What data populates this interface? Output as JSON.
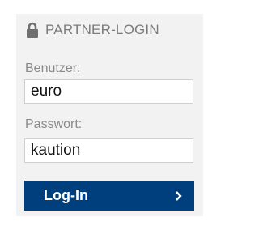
{
  "login": {
    "heading": "PARTNER-LOGIN",
    "username_label": "Benutzer:",
    "username_value": "euro",
    "password_label": "Passwort:",
    "password_value": "kaution",
    "submit_label": "Log-In"
  },
  "icons": {
    "header": "lock-icon",
    "submit": "chevron-right-icon"
  },
  "colors": {
    "panel_bg": "#f2f2f2",
    "button_bg": "#003f7d",
    "heading_text": "#7b7b7b",
    "label_text": "#8a8a8a"
  }
}
